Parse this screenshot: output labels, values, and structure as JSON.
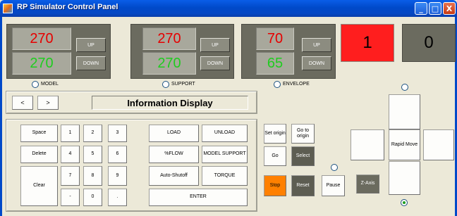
{
  "window": {
    "title": "RP Simulator Control Panel",
    "controls": {
      "minimize": "_",
      "maximize": "□",
      "close": "X"
    }
  },
  "panels": [
    {
      "key": "model",
      "top_value": "270",
      "bottom_value": "270",
      "up_label": "UP",
      "down_label": "DOWN",
      "radio_label": "MODEL"
    },
    {
      "key": "support",
      "top_value": "270",
      "bottom_value": "270",
      "up_label": "UP",
      "down_label": "DOWN",
      "radio_label": "SUPPORT"
    },
    {
      "key": "envelope",
      "top_value": "70",
      "bottom_value": "65",
      "up_label": "UP",
      "down_label": "DOWN",
      "radio_label": "ENVELOPE"
    }
  ],
  "indicators": {
    "red_value": "1",
    "gray_value": "0"
  },
  "info": {
    "prev": "<",
    "next": ">",
    "title": "Information Display"
  },
  "keypad": {
    "space": "Space",
    "delete": "Delete",
    "clear": "Clear",
    "k1": "1",
    "k2": "2",
    "k3": "3",
    "k4": "4",
    "k5": "5",
    "k6": "6",
    "k7": "7",
    "k8": "8",
    "k9": "9",
    "minus": "-",
    "k0": "0",
    "dot": ".",
    "load": "LOAD",
    "unload": "UNLOAD",
    "flow": "%FLOW",
    "model_support": "MODEL SUPPORT",
    "auto_shutoff": "Auto-Shutoff",
    "torque": "TORQUE",
    "enter": "ENTER"
  },
  "motion": {
    "set_origin": "Set origin",
    "goto_origin": "Go to origin",
    "go": "Go",
    "select": "Select",
    "stop": "Stop",
    "reset": "Reset",
    "pause": "Pause",
    "z_axis": "Z-Axis",
    "rapid_move": "Rapid Move"
  },
  "colors": {
    "titlebar": "#0049c9",
    "panel_bg": "#6b6b5f",
    "value_red": "#e60000",
    "value_green": "#1fcc1f",
    "indicator_red": "#ff1e1e",
    "stop_orange": "#ff8000",
    "dark_button": "#5d5d52"
  }
}
